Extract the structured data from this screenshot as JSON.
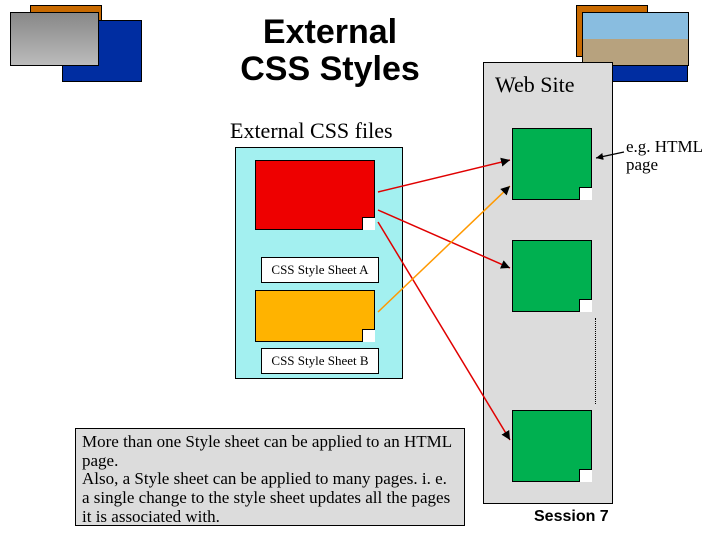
{
  "title": "External CSS Styles",
  "subtitle": "External CSS files",
  "website_label": "Web Site",
  "sheet_a_label": "CSS Style Sheet A",
  "sheet_b_label": "CSS Style Sheet B",
  "eg_label": "e.g. HTML page",
  "note": "More than one Style sheet can be applied to an HTML page.\nAlso, a Style sheet can be applied to many pages. i. e. a single change to the style sheet updates all the pages it is associated with.",
  "session": "Session 7"
}
